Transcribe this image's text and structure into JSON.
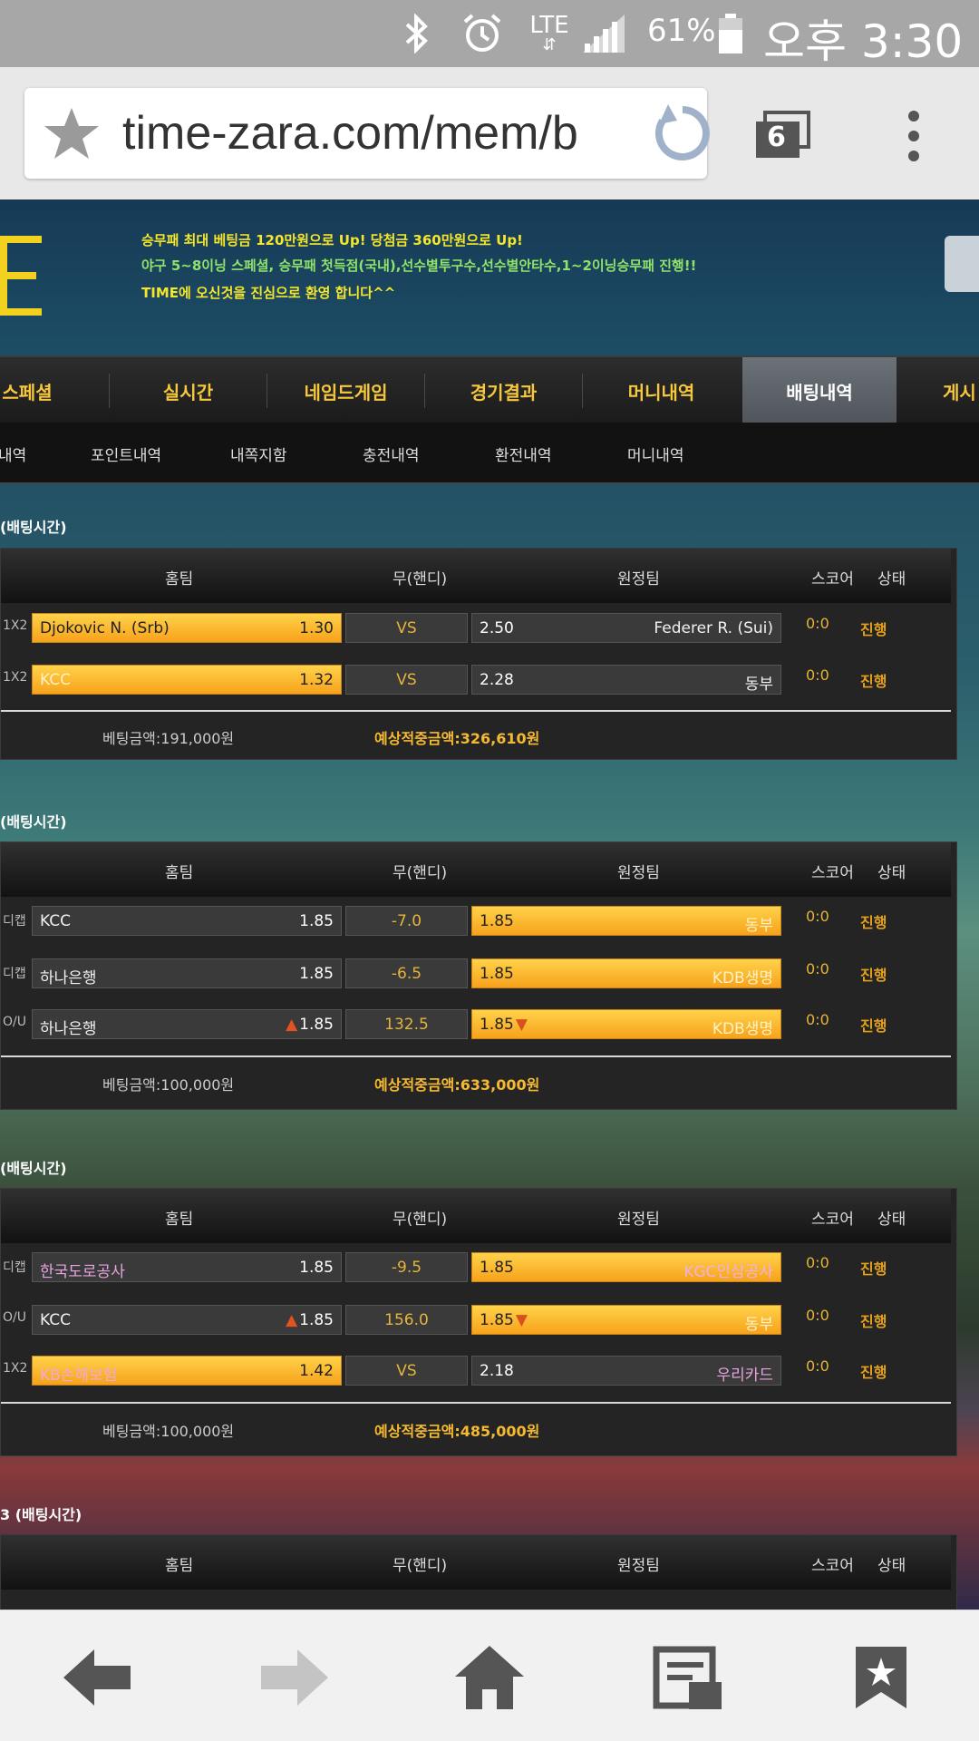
{
  "status_bar": {
    "battery_percent": "61%",
    "time": "오후 3:30",
    "network": "LTE"
  },
  "browser": {
    "url": "time-zara.com/mem/b",
    "tab_count": "6"
  },
  "banner": {
    "line1": "승무패 최대 베팅금 120만원으로 Up! 당첨금 360만원으로 Up!",
    "line2": "야구 5~8이닝 스페셜, 승무패 첫득점(국내),선수별투구수,선수별안타수,1~2이닝승무패 진행!!",
    "line3": "TIME에 오신것을 진심으로 환영 합니다^^"
  },
  "main_nav": [
    "스페셜",
    "실시간",
    "네임드게임",
    "경기결과",
    "머니내역",
    "배팅내역",
    "게시"
  ],
  "sub_nav": [
    "내역",
    "포인트내역",
    "내쪽지함",
    "충전내역",
    "환전내역",
    "머니내역"
  ],
  "table_headers": {
    "home": "홈팀",
    "draw": "무(핸디)",
    "away": "원정팀",
    "score": "스코어",
    "status": "상태"
  },
  "bets": [
    {
      "title": "(배팅시간)",
      "rows": [
        {
          "type": "1X2",
          "home": "Djokovic N. (Srb)",
          "home_odds": "1.30",
          "mid": "VS",
          "away_odds": "2.50",
          "away": "Federer R. (Sui)",
          "score": "0:0",
          "status": "진행"
        },
        {
          "type": "1X2",
          "home": "KCC",
          "home_odds": "1.32",
          "mid": "VS",
          "away_odds": "2.28",
          "away": "동부",
          "score": "0:0",
          "status": "진행"
        }
      ],
      "bet_amount": "베팅금액:191,000원",
      "expected_win": "예상적중금액:326,610원"
    },
    {
      "title": "(배팅시간)",
      "rows": [
        {
          "type": "디캡",
          "home": "KCC",
          "home_odds": "1.85",
          "mid": "-7.0",
          "away_odds": "1.85",
          "away": "동부",
          "score": "0:0",
          "status": "진행"
        },
        {
          "type": "디캡",
          "home": "하나은행",
          "home_odds": "1.85",
          "mid": "-6.5",
          "away_odds": "1.85",
          "away": "KDB생명",
          "score": "0:0",
          "status": "진행"
        },
        {
          "type": "O/U",
          "home": "하나은행",
          "home_odds": "1.85",
          "mid": "132.5",
          "away_odds": "1.85",
          "away": "KDB생명",
          "score": "0:0",
          "status": "진행"
        }
      ],
      "bet_amount": "베팅금액:100,000원",
      "expected_win": "예상적중금액:633,000원"
    },
    {
      "title": "(배팅시간)",
      "rows": [
        {
          "type": "디캡",
          "home": "한국도로공사",
          "home_odds": "1.85",
          "mid": "-9.5",
          "away_odds": "1.85",
          "away": "KGC인삼공사",
          "score": "0:0",
          "status": "진행"
        },
        {
          "type": "O/U",
          "home": "KCC",
          "home_odds": "1.85",
          "mid": "156.0",
          "away_odds": "1.85",
          "away": "동부",
          "score": "0:0",
          "status": "진행"
        },
        {
          "type": "1X2",
          "home": "KB손해보험",
          "home_odds": "1.42",
          "mid": "VS",
          "away_odds": "2.18",
          "away": "우리카드",
          "score": "0:0",
          "status": "진행"
        }
      ],
      "bet_amount": "베팅금액:100,000원",
      "expected_win": "예상적중금액:485,000원"
    },
    {
      "title": "3 (배팅시간)"
    }
  ],
  "colors": {
    "highlight": "#f7a21b",
    "nav_text": "#f7c83b",
    "status": "#e5a11b"
  }
}
